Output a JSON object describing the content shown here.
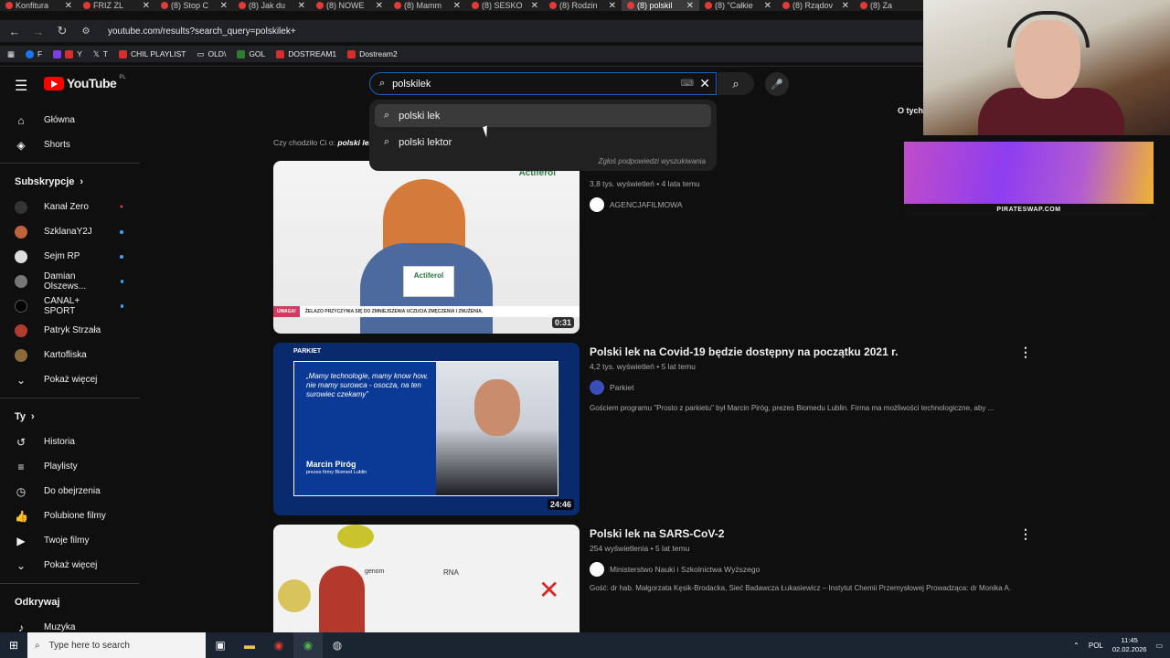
{
  "browser": {
    "tabs": [
      {
        "label": "Konfitura"
      },
      {
        "label": "FRIZ ZL"
      },
      {
        "label": "(8) Stop C"
      },
      {
        "label": "(8) Jak du"
      },
      {
        "label": "(8) NOWE"
      },
      {
        "label": "(8) Mamm"
      },
      {
        "label": "(8) SESKO"
      },
      {
        "label": "(8) Rodzin"
      },
      {
        "label": "(8) polskil",
        "active": true
      },
      {
        "label": "(8) \"Całkie"
      },
      {
        "label": "(8) Rządov"
      },
      {
        "label": "(8) Za"
      }
    ],
    "url": "youtube.com/results?search_query=polskilek+",
    "bookmarks": [
      {
        "label": "F"
      },
      {
        "label": "Y"
      },
      {
        "label": "T"
      },
      {
        "label": "CHIL PLAYLIST"
      },
      {
        "label": "OLD\\"
      },
      {
        "label": "GOL"
      },
      {
        "label": "DOSTREAM1"
      },
      {
        "label": "Dostream2"
      }
    ]
  },
  "masthead": {
    "logo_text": "YouTube",
    "region": "PL",
    "search_value": "polskilek",
    "right_cut": "O tych"
  },
  "suggestions": {
    "items": [
      "polski lek",
      "polski lektor"
    ],
    "report": "Zgłoś podpowiedzi wyszukiwania"
  },
  "sidebar": {
    "main": [
      {
        "label": "Główna",
        "icon": "home-icon"
      },
      {
        "label": "Shorts",
        "icon": "shorts-icon"
      }
    ],
    "subs_title": "Subskrypcje",
    "subs": [
      {
        "label": "Kanał Zero",
        "badge": "live"
      },
      {
        "label": "SzklanaY2J",
        "badge": "dot"
      },
      {
        "label": "Sejm RP",
        "badge": "dot"
      },
      {
        "label": "Damian Olszews...",
        "badge": "dot"
      },
      {
        "label": "CANAL+ SPORT",
        "badge": "dot"
      },
      {
        "label": "Patryk Strzała",
        "badge": ""
      },
      {
        "label": "Kartofliska",
        "badge": ""
      }
    ],
    "subs_more": "Pokaż więcej",
    "you_title": "Ty",
    "you": [
      {
        "label": "Historia",
        "icon": "history-icon"
      },
      {
        "label": "Playlisty",
        "icon": "playlist-icon"
      },
      {
        "label": "Do obejrzenia",
        "icon": "clock-icon"
      },
      {
        "label": "Polubione filmy",
        "icon": "thumbs-up-icon"
      },
      {
        "label": "Twoje filmy",
        "icon": "video-icon"
      }
    ],
    "you_more": "Pokaż więcej",
    "explore_title": "Odkrywaj",
    "explore": [
      {
        "label": "Muzyka",
        "icon": "music-icon"
      }
    ]
  },
  "results": {
    "did_you_mean_prefix": "Czy chodziło Ci o:",
    "did_you_mean": "polski lek",
    "videos": [
      {
        "title": "",
        "views": "3,8 tys. wyświetleń",
        "age": "4 lata temu",
        "channel": "AGENCJAFILMOWA",
        "description": "",
        "duration": "0:31",
        "thumb_text": "Actiferol",
        "thumb_banner": "ŻELAZO PRZYCZYNIA SIĘ DO ZMNIEJSZENIA UCZUCIA ZMĘCZENIA I ZNUŻENIA.",
        "thumb_warn": "UWAGA!"
      },
      {
        "title": "Polski lek na Covid-19 będzie dostępny na początku 2021 r.",
        "views": "4,2 tys. wyświetleń",
        "age": "5 lat temu",
        "channel": "Parkiet",
        "description": "Gościem programu \"Prosto z parkietu\" był Marcin Piróg, prezes Biomedu Lublin. Firma ma możliwości technologiczne, aby ...",
        "duration": "24:46",
        "thumb_brand": "PARKIET",
        "thumb_quote": "„Mamy technologie, mamy know how, nie mamy surowca - osocza, na ten surowiec czekamy”",
        "thumb_name": "Marcin Piróg",
        "thumb_role": "prezes firmy Biomed Lublin"
      },
      {
        "title": "Polski lek na SARS-CoV-2",
        "views": "254 wyświetlenia",
        "age": "5 lat temu",
        "channel": "Ministerstwo Nauki i Szkolnictwa Wyższego",
        "description": "Gość: dr hab. Małgorzata Kęsik-Brodacka, Sieć Badawcza Łukasiewicz – Instytut Chemii Przemysłowej Prowadząca: dr Monika A.",
        "duration": "",
        "thumb_label1": "genom",
        "thumb_label2": "RNA"
      }
    ]
  },
  "ad": {
    "footer": "PIRATESWAP.COM"
  },
  "taskbar": {
    "search_placeholder": "Type here to search",
    "lang": "POL",
    "time": "11:45",
    "date": "02.02.2026"
  },
  "colors": {
    "accent": "#3ea6ff",
    "brand": "#ff0000",
    "bg": "#0f0f0f"
  }
}
